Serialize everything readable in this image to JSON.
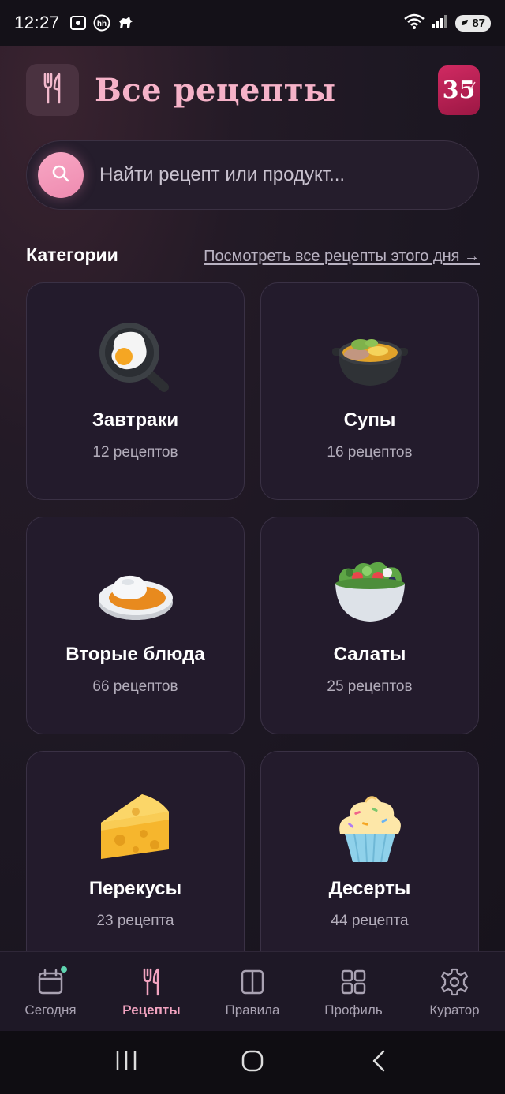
{
  "status_bar": {
    "time": "12:27",
    "battery": "87",
    "icons": [
      "screenshot-icon",
      "hh-icon",
      "dog-icon",
      "wifi-icon",
      "signal-icon",
      "battery-icon"
    ]
  },
  "header": {
    "title": "Все рецепты",
    "logo_icon": "fork-knife-icon",
    "streak_count": "35"
  },
  "search": {
    "placeholder": "Найти рецепт или продукт..."
  },
  "categories_section": {
    "title": "Категории",
    "link": "Посмотреть все рецепты этого дня →"
  },
  "categories": [
    {
      "title": "Завтраки",
      "count": "12 рецептов",
      "icon": "fried-egg-icon"
    },
    {
      "title": "Супы",
      "count": "16 рецептов",
      "icon": "soup-pot-icon"
    },
    {
      "title": "Вторые блюда",
      "count": "66 рецептов",
      "icon": "curry-rice-icon"
    },
    {
      "title": "Салаты",
      "count": "25 рецептов",
      "icon": "salad-bowl-icon"
    },
    {
      "title": "Перекусы",
      "count": "23 рецепта",
      "icon": "cheese-icon"
    },
    {
      "title": "Десерты",
      "count": "44 рецепта",
      "icon": "cupcake-icon"
    }
  ],
  "bottom_nav": [
    {
      "label": "Сегодня",
      "icon": "calendar-icon",
      "active": false
    },
    {
      "label": "Рецепты",
      "icon": "fork-knife-icon",
      "active": true
    },
    {
      "label": "Правила",
      "icon": "book-icon",
      "active": false
    },
    {
      "label": "Профиль",
      "icon": "grid-icon",
      "active": false
    },
    {
      "label": "Куратор",
      "icon": "gear-icon",
      "active": false
    }
  ],
  "colors": {
    "accent": "#f6b2c8",
    "active_nav": "#f2a3c0",
    "streak_badge": "#c02255",
    "card_bg": "#231b2c"
  }
}
